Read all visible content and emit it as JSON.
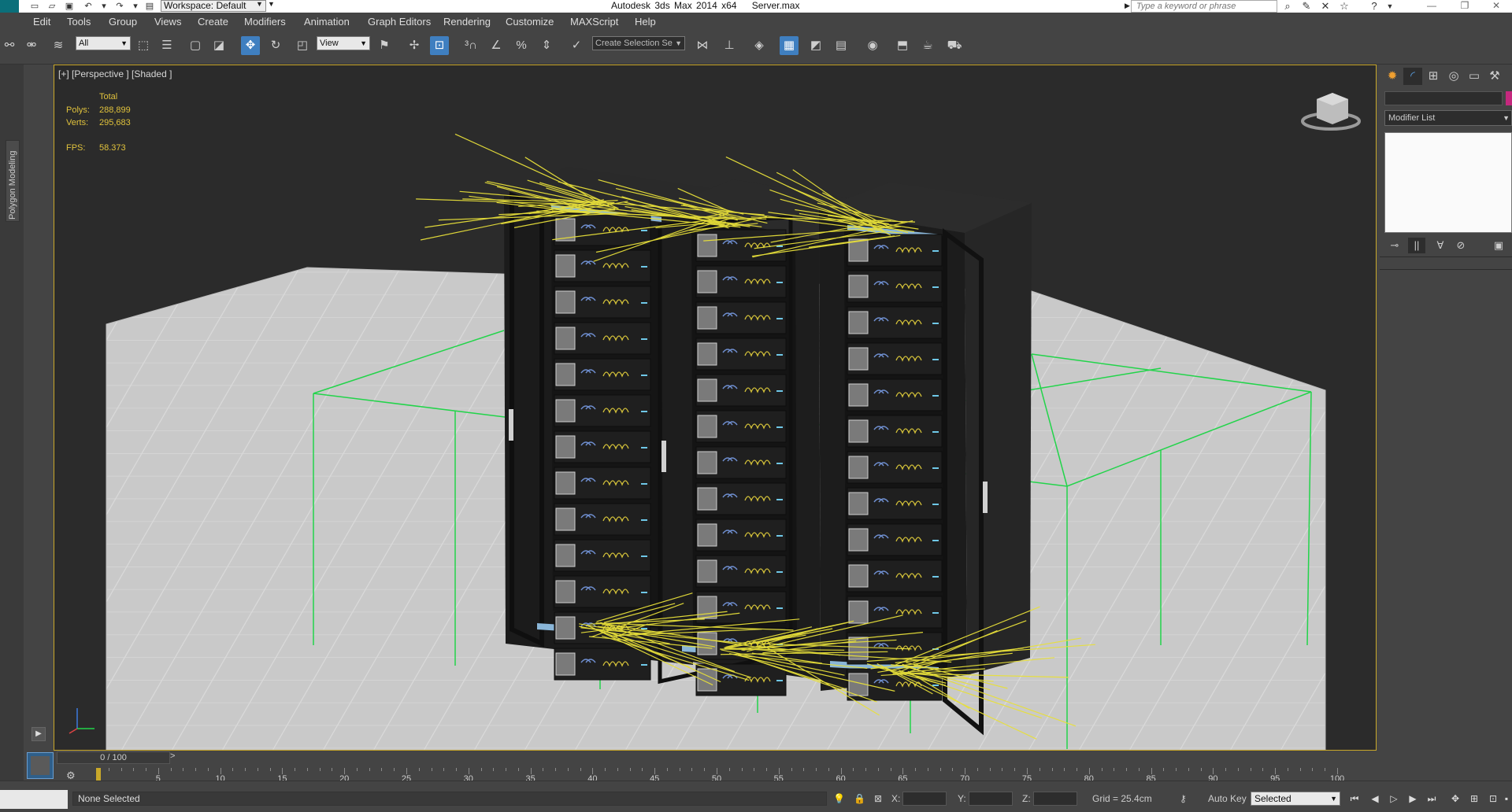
{
  "title_bar": {
    "workspace": "Workspace: Default",
    "app_title": "Autodesk 3ds Max  2014 x64",
    "file_name": "Server.max",
    "search_placeholder": "Type a keyword or phrase"
  },
  "menu": [
    "Edit",
    "Tools",
    "Group",
    "Views",
    "Create",
    "Modifiers",
    "Animation",
    "Graph Editors",
    "Rendering",
    "Customize",
    "MAXScript",
    "Help"
  ],
  "toolbar": {
    "selection_filter": "All",
    "reference_coord": "View",
    "named_selection": "Create Selection Se"
  },
  "left_strip": {
    "tab_label": "Polygon Modeling"
  },
  "viewport": {
    "label": "[+] [Perspective ] [Shaded ]",
    "stats": {
      "header": "Total",
      "polys_label": "Polys:",
      "polys": "288,899",
      "verts_label": "Verts:",
      "verts": "295,683",
      "fps_label": "FPS:",
      "fps": "58.373"
    },
    "colors": {
      "frame": "#c9a82a",
      "background": "#2b2b2b",
      "floor": "#c8c8c8",
      "wireframe": "#22d44a",
      "lights": "#e8e03a"
    }
  },
  "command_panel": {
    "modifier_list": "Modifier List",
    "object_color": "#c5287e"
  },
  "timeline": {
    "slider": "0 / 100",
    "ticks": [
      "5",
      "10",
      "15",
      "20",
      "25",
      "30",
      "35",
      "40",
      "45",
      "50",
      "55",
      "60",
      "65",
      "70",
      "75",
      "80",
      "85",
      "90",
      "95",
      "100"
    ]
  },
  "status": {
    "selection": "None Selected",
    "x_label": "X:",
    "y_label": "Y:",
    "z_label": "Z:",
    "grid": "Grid = 25.4cm",
    "auto_key": "Auto Key",
    "key_mode": "Selected"
  }
}
